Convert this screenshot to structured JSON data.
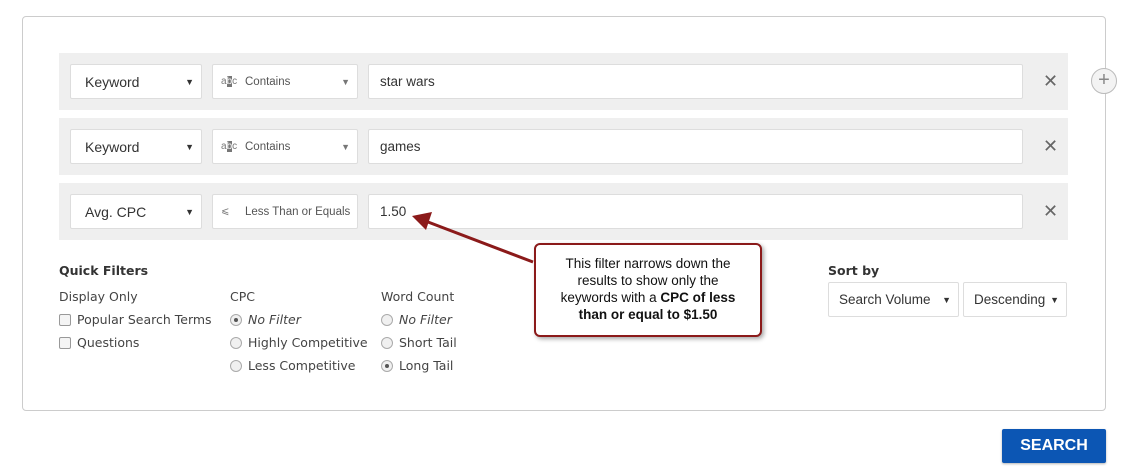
{
  "filters": [
    {
      "field": "Keyword",
      "operator": "Contains",
      "operator_icon": "abc-icon",
      "value": "star wars"
    },
    {
      "field": "Keyword",
      "operator": "Contains",
      "operator_icon": "abc-icon",
      "value": "games"
    },
    {
      "field": "Avg. CPC",
      "operator": "Less Than or Equals",
      "operator_icon": "less-equal-icon",
      "value": "1.50"
    }
  ],
  "quick_filters": {
    "title": "Quick Filters",
    "display_only": {
      "label": "Display Only",
      "options": [
        "Popular Search Terms",
        "Questions"
      ]
    },
    "cpc": {
      "label": "CPC",
      "options": [
        "No Filter",
        "Highly Competitive",
        "Less Competitive"
      ],
      "selected": "No Filter"
    },
    "word_count": {
      "label": "Word Count",
      "options": [
        "No Filter",
        "Short Tail",
        "Long Tail"
      ],
      "selected": "Long Tail"
    }
  },
  "sort": {
    "label": "Sort by",
    "field": "Search Volume",
    "order": "Descending"
  },
  "callout": {
    "text_before": "This filter narrows down the results to show only the keywords with a ",
    "text_bold": "CPC of less than or equal to $1.50"
  },
  "search_label": "SEARCH",
  "colors": {
    "accent": "#0c56b4",
    "callout": "#8b1a1a"
  }
}
